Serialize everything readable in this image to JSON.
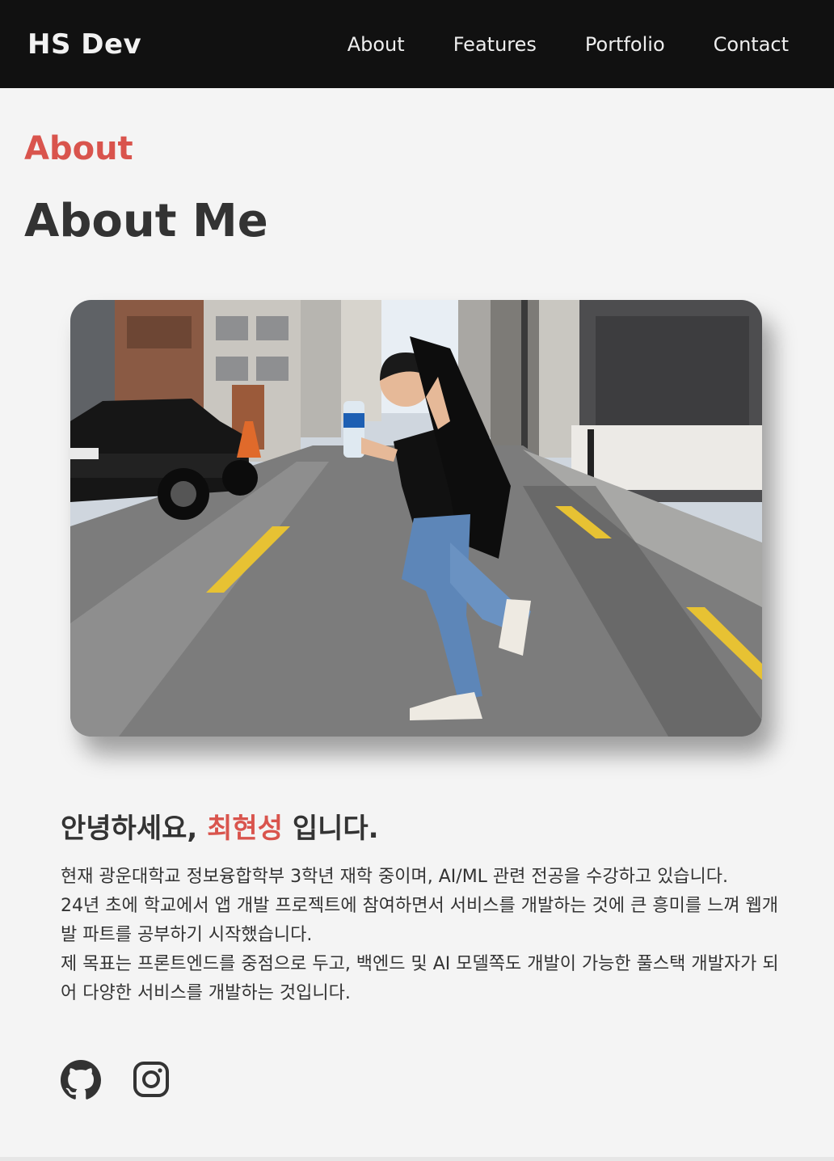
{
  "header": {
    "brand": "HS Dev",
    "nav": [
      {
        "label": "About"
      },
      {
        "label": "Features"
      },
      {
        "label": "Portfolio"
      },
      {
        "label": "Contact"
      }
    ]
  },
  "about": {
    "tag": "About",
    "title": "About Me",
    "photo_icon": "portrait-photo",
    "greeting_prefix": "안녕하세요, ",
    "greeting_name": "최현성",
    "greeting_suffix": " 입니다.",
    "bio": [
      "현재 광운대학교 정보융합학부 3학년 재학 중이며, AI/ML 관련 전공을 수강하고 있습니다.",
      "24년 초에 학교에서 앱 개발 프로젝트에 참여하면서 서비스를 개발하는 것에 큰 흥미를 느껴 웹개발 파트를 공부하기 시작했습니다.",
      "제 목표는 프론트엔드를 중점으로 두고, 백엔드 및 AI 모델쪽도 개발이 가능한 풀스택 개발자가 되어 다양한 서비스를 개발하는 것입니다."
    ],
    "socials": [
      {
        "icon": "github-icon"
      },
      {
        "icon": "instagram-icon"
      }
    ]
  },
  "colors": {
    "accent": "#d9544d",
    "nav_bg": "#111111",
    "page_bg": "#f4f4f4",
    "text": "#333333"
  }
}
